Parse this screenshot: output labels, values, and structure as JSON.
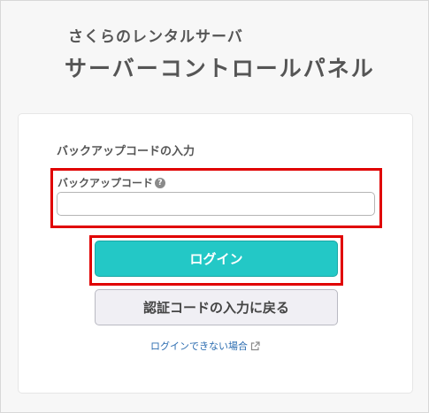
{
  "brand": {
    "subtitle": "さくらのレンタルサーバ",
    "title": "サーバーコントロールパネル"
  },
  "form": {
    "heading": "バックアップコードの入力",
    "field_label": "バックアップコード",
    "input_value": "",
    "help_glyph": "?"
  },
  "buttons": {
    "login": "ログイン",
    "auth_code": "認証コードの入力に戻る"
  },
  "links": {
    "cannot_login": "ログインできない場合"
  },
  "icons": {
    "help": "question-circle-icon",
    "external": "external-link-icon"
  },
  "colors": {
    "primary": "#23c8c6",
    "highlight": "#e00000",
    "link": "#2b6cb0"
  }
}
